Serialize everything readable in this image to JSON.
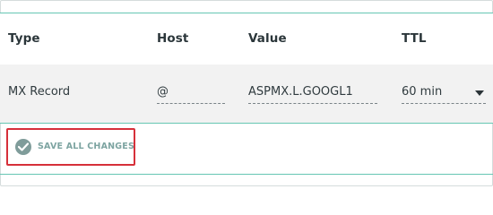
{
  "table": {
    "columns": {
      "type": "Type",
      "host": "Host",
      "value": "Value",
      "ttl": "TTL"
    },
    "row": {
      "type": "MX Record",
      "host": "@",
      "value": "ASPMX.L.GOOGL1",
      "ttl": "60 min"
    }
  },
  "actions": {
    "save_all_label": "SAVE ALL CHANGES"
  },
  "icons": {
    "save": "check-circle-icon",
    "ttl_dropdown": "caret-down-icon"
  },
  "colors": {
    "accent": "#66c6b3",
    "highlight": "#d6303a",
    "button_text": "#7da4a1"
  }
}
